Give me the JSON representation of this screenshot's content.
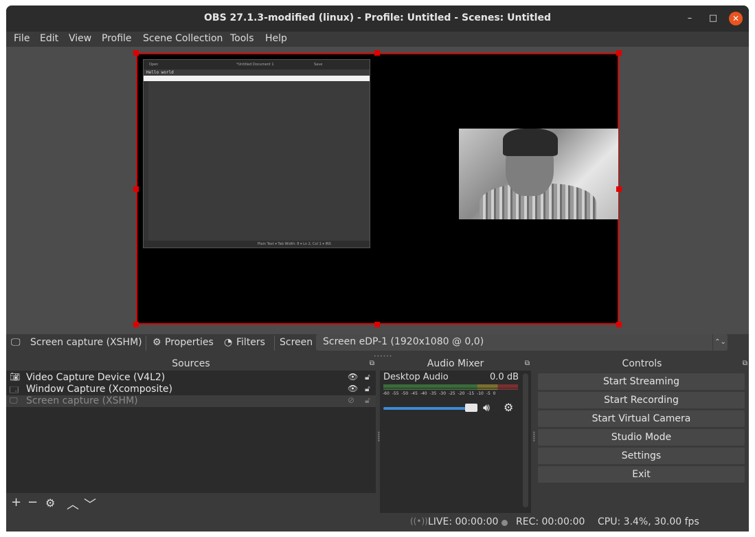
{
  "window": {
    "title": "OBS 27.1.3-modified (linux) - Profile: Untitled - Scenes: Untitled",
    "min_glyph": "–",
    "max_glyph": "□",
    "close_glyph": "✕"
  },
  "menu": {
    "items": [
      "File",
      "Edit",
      "View",
      "Profile",
      "Scene Collection",
      "Tools",
      "Help"
    ]
  },
  "editor": {
    "title": "*Untitled Document 1",
    "open_label": "Open",
    "save_label": "Save",
    "content": "Hello world",
    "status": "Plain Text ▾    Tab Width: 8 ▾    Ln 2, Col 1    ▾  INS"
  },
  "source_toolbar": {
    "source_name": "Screen capture (XSHM)",
    "properties_label": "Properties",
    "filters_label": "Filters",
    "screen_label": "Screen",
    "screen_value": "Screen eDP-1 (1920x1080 @ 0,0)"
  },
  "sources": {
    "title": "Sources",
    "items": [
      {
        "name": "Video Capture Device (V4L2)",
        "icon": "camera-icon",
        "visible": true
      },
      {
        "name": "Window Capture (Xcomposite)",
        "icon": "window-icon",
        "visible": true
      },
      {
        "name": "Screen capture (XSHM)",
        "icon": "monitor-icon",
        "visible": false
      }
    ]
  },
  "mixer": {
    "title": "Audio Mixer",
    "channel_name": "Desktop Audio",
    "level": "0.0 dB",
    "scale": "-60 -55 -50 -45 -40 -35 -30 -25 -20 -15 -10 -5 0",
    "volume": 0.9
  },
  "controls": {
    "title": "Controls",
    "buttons": [
      "Start Streaming",
      "Start Recording",
      "Start Virtual Camera",
      "Studio Mode",
      "Settings",
      "Exit"
    ]
  },
  "status": {
    "live": "LIVE: 00:00:00",
    "rec": "REC: 00:00:00",
    "cpu": "CPU: 3.4%, 30.00 fps"
  },
  "colors": {
    "selection_border": "#e00000",
    "volume_track": "#3c8ad6",
    "close_button": "#e9541f"
  }
}
